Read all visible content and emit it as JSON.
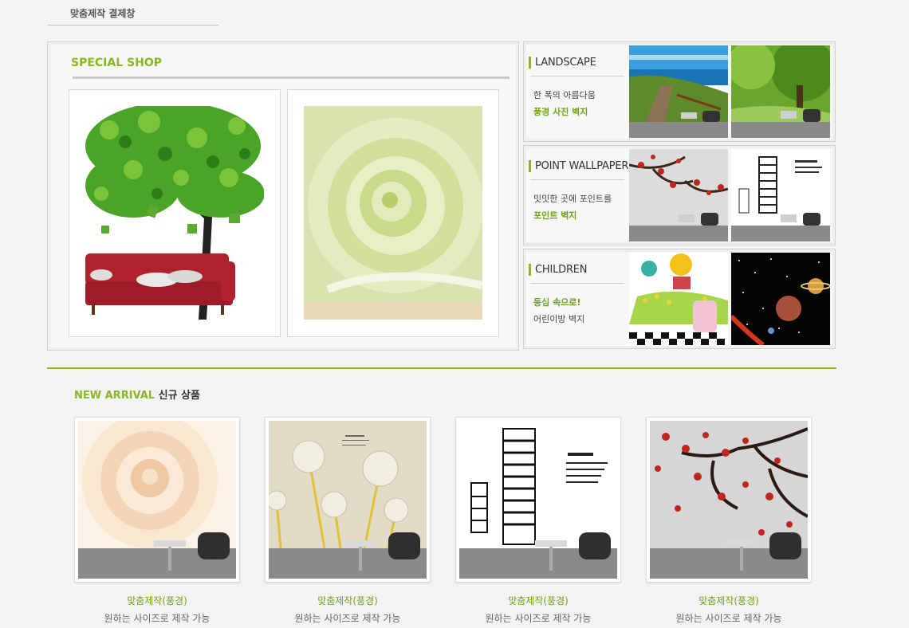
{
  "page": {
    "title": "맞춤제작 결제창"
  },
  "special_shop": {
    "heading": "SPECIAL SHOP",
    "items": [
      {
        "name": "tree-sofa-wallpaper"
      },
      {
        "name": "green-rose-wallpaper"
      }
    ]
  },
  "categories": [
    {
      "title": "LANDSCAPE",
      "line1": "한 폭의 아름다움",
      "line2": "풍경 사진 벽지"
    },
    {
      "title": "POINT WALLPAPER",
      "line1": "밋밋한 곳에 포인트를",
      "line2": "포인트 벽지"
    },
    {
      "title": "CHILDREN",
      "line1": "동심 속으로!",
      "line2": "어린이방 벽지"
    }
  ],
  "new_arrival": {
    "heading_en": "NEW ARRIVAL",
    "heading_ko": "신규 상품",
    "products": [
      {
        "label": "맞춤제작(풍경)",
        "desc": "원하는 사이즈로 제작 가능"
      },
      {
        "label": "맞춤제작(풍경)",
        "desc": "원하는 사이즈로 제작 가능"
      },
      {
        "label": "맞춤제작(풍경)",
        "desc": "원하는 사이즈로 제작 가능"
      },
      {
        "label": "맞춤제작(풍경)",
        "desc": "원하는 사이즈로 제작 가능"
      }
    ]
  },
  "colors": {
    "accent": "#8cb522",
    "accent_dark": "#6fa318",
    "background": "#f4f3f3"
  }
}
